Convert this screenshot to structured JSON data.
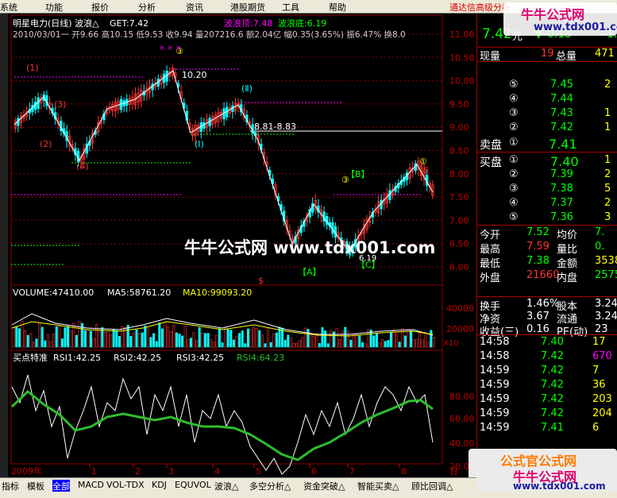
{
  "menu": {
    "items": [
      "系统",
      "功能",
      "报价",
      "分析",
      "资讯",
      "港股期货",
      "工具",
      "帮助"
    ],
    "brand": "通达信高级分析"
  },
  "watermark": {
    "top_cn": "牛牛公式网",
    "top_url": "www.tdx001.com",
    "center": "牛牛公式网 www.tdx001.com",
    "bottom_cn1": "公式官公式网",
    "bottom_cn2": "牛牛公式网",
    "bottom_url": "www.tdx001.com"
  },
  "main": {
    "title": "明星电力(日线) 波浪△",
    "get": "GET:7.42",
    "wave_top": "波浪顶:7.48",
    "wave_bottom": "波浪底:6.19",
    "info_line": "2010/03/01一 开9.66 高10.15 低9.53 收9.94 量207216.6 额2.04亿 幅0.35(3.65%) 振6.47% 换8.0",
    "y_ticks": [
      "11.00",
      "10.50",
      "10.00",
      "9.50",
      "9.00",
      "8.50",
      "8.00",
      "7.50",
      "7.00",
      "6.50",
      "6.00"
    ],
    "annotations": {
      "high": "10.20",
      "range": "8.81-8.83",
      "low": "6.19",
      "w1": "①",
      "w2": "②",
      "w3": "③",
      "w4": "④",
      "w5": "⑤",
      "wI": "(Ⅰ)",
      "wII": "(Ⅱ)",
      "A": "【A】",
      "B": "【B】",
      "C": "【C】",
      "s": "$"
    }
  },
  "volume": {
    "title": "VOLUME:47410.00",
    "ma5": "MA5:58761.20",
    "ma10": "MA10:99093.20",
    "y_ticks": [
      "40000",
      "20000"
    ],
    "unit": "X10"
  },
  "rsi": {
    "title": "买点特准",
    "rsi1": "RSI1:42.25",
    "rsi2": "RSI2:42.25",
    "rsi3": "RSI3:42.25",
    "rsi4": "RSI4:64.23",
    "y_ticks": [
      "80.00",
      "60.00",
      "40.00",
      "20.00"
    ]
  },
  "xaxis": {
    "labels": [
      "2009年",
      "1",
      "2",
      "3",
      "4",
      "5",
      "6",
      "7",
      "8",
      "日"
    ]
  },
  "quote": {
    "price": "7.42",
    "unit": "元",
    "change": "▼-0.13",
    "change_tail": "-1.",
    "xianliang_label": "现量",
    "xianliang": "19",
    "zongliang_label": "总量",
    "zongliang": "471",
    "sell_label": "卖盘",
    "buy_label": "买盘",
    "sells": [
      {
        "n": "⑤",
        "p": "7.45",
        "v": "2"
      },
      {
        "n": "④",
        "p": "7.44",
        "v": ""
      },
      {
        "n": "③",
        "p": "7.43",
        "v": "1"
      },
      {
        "n": "②",
        "p": "7.42",
        "v": "1"
      },
      {
        "n": "①",
        "p": "7.41",
        "v": ""
      }
    ],
    "buys": [
      {
        "n": "①",
        "p": "7.40",
        "v": "1"
      },
      {
        "n": "②",
        "p": "7.39",
        "v": "2"
      },
      {
        "n": "③",
        "p": "7.38",
        "v": "5"
      },
      {
        "n": "④",
        "p": "7.37",
        "v": "2"
      },
      {
        "n": "⑤",
        "p": "7.36",
        "v": "3"
      }
    ],
    "stats": [
      {
        "l1": "今开",
        "v1": "7.52",
        "l2": "均价",
        "v2": "7."
      },
      {
        "l1": "最高",
        "v1": "7.59",
        "l2": "量比",
        "v2": "0."
      },
      {
        "l1": "最低",
        "v1": "7.38",
        "l2": "金额",
        "v2": "3538"
      },
      {
        "l1": "外盘",
        "v1": "21660",
        "l2": "内盘",
        "v2": "2575"
      }
    ],
    "stats2": [
      {
        "l1": "换手",
        "v1": "1.46%",
        "l2": "股本",
        "v2": "3.24"
      },
      {
        "l1": "净资",
        "v1": "3.67",
        "l2": "流通",
        "v2": "3.24"
      },
      {
        "l1": "收益(三)",
        "v1": "0.16",
        "l2": "PE(动)",
        "v2": "23"
      }
    ],
    "ticks": [
      {
        "t": "14:58",
        "p": "7.40",
        "v": "17"
      },
      {
        "t": "14:58",
        "p": "7.42",
        "v": "670"
      },
      {
        "t": "14:59",
        "p": "7.42",
        "v": "7"
      },
      {
        "t": "14:59",
        "p": "7.42",
        "v": "36"
      },
      {
        "t": "14:59",
        "p": "7.42",
        "v": "203"
      },
      {
        "t": "14:59",
        "p": "7.42",
        "v": "204"
      },
      {
        "t": "14:59",
        "p": "7.41",
        "v": "6"
      }
    ]
  },
  "bottom_tabs": [
    "指标",
    "模板",
    "全部",
    "MACD",
    "VOL-TDX",
    "KDJ",
    "EQUVOL",
    "波浪△",
    "多空分析△",
    "资金突破△",
    "智能买卖△",
    "顾比回调△"
  ],
  "colors": {
    "up": "#ff3232",
    "down": "#00ffff",
    "grid": "#8b0000",
    "wave": "#ffffff",
    "rsi_green": "#2ebd2e",
    "magenta": "#ff00ff",
    "yellow": "#ffff00"
  }
}
